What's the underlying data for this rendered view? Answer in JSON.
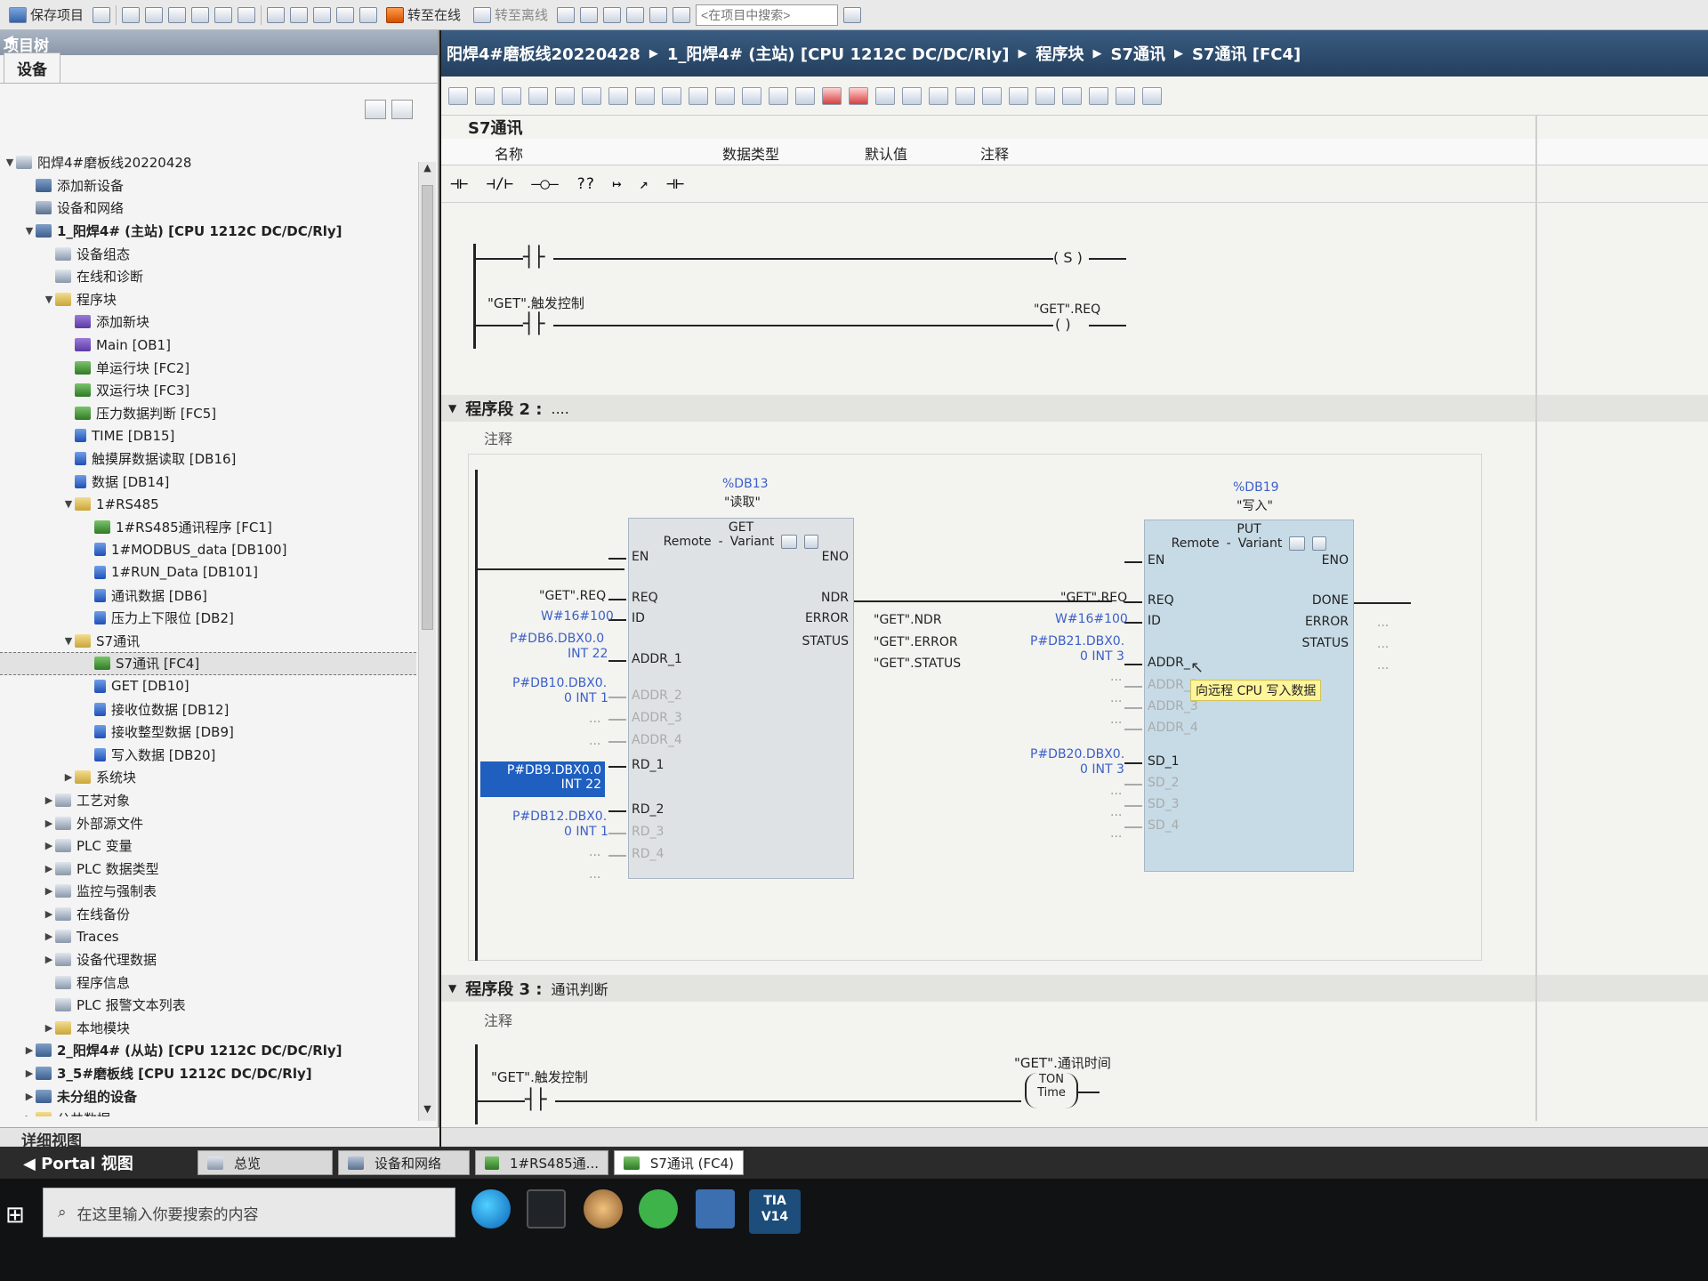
{
  "toolbar": {
    "save_label": "保存项目",
    "go_online": "转至在线",
    "go_offline": "转至离线",
    "search_placeholder": "<在项目中搜索>"
  },
  "left_panel": {
    "title": "项目树",
    "tab": "设备",
    "detail_view": "详细视图",
    "tree": [
      {
        "label": "阳焊4#磨板线20220428",
        "depth": 0,
        "arrow": "▼",
        "icon": "gen"
      },
      {
        "label": "添加新设备",
        "depth": 1,
        "arrow": "",
        "icon": "dev"
      },
      {
        "label": "设备和网络",
        "depth": 1,
        "arrow": "",
        "icon": "net"
      },
      {
        "label": "1_阳焊4# (主站) [CPU 1212C DC/DC/Rly]",
        "depth": 1,
        "arrow": "▼",
        "icon": "dev",
        "bold": true
      },
      {
        "label": "设备组态",
        "depth": 2,
        "arrow": "",
        "icon": "gen"
      },
      {
        "label": "在线和诊断",
        "depth": 2,
        "arrow": "",
        "icon": "gen"
      },
      {
        "label": "程序块",
        "depth": 2,
        "arrow": "▼",
        "icon": "fold"
      },
      {
        "label": "添加新块",
        "depth": 3,
        "arrow": "",
        "icon": "ob"
      },
      {
        "label": "Main [OB1]",
        "depth": 3,
        "arrow": "",
        "icon": "ob"
      },
      {
        "label": "单运行块 [FC2]",
        "depth": 3,
        "arrow": "",
        "icon": "fc"
      },
      {
        "label": "双运行块 [FC3]",
        "depth": 3,
        "arrow": "",
        "icon": "fc"
      },
      {
        "label": "压力数据判断 [FC5]",
        "depth": 3,
        "arrow": "",
        "icon": "fc"
      },
      {
        "label": "TIME [DB15]",
        "depth": 3,
        "arrow": "",
        "icon": "db"
      },
      {
        "label": "触摸屏数据读取 [DB16]",
        "depth": 3,
        "arrow": "",
        "icon": "db"
      },
      {
        "label": "数据 [DB14]",
        "depth": 3,
        "arrow": "",
        "icon": "db"
      },
      {
        "label": "1#RS485",
        "depth": 3,
        "arrow": "▼",
        "icon": "fold"
      },
      {
        "label": "1#RS485通讯程序 [FC1]",
        "depth": 4,
        "arrow": "",
        "icon": "fc"
      },
      {
        "label": "1#MODBUS_data [DB100]",
        "depth": 4,
        "arrow": "",
        "icon": "db"
      },
      {
        "label": "1#RUN_Data [DB101]",
        "depth": 4,
        "arrow": "",
        "icon": "db"
      },
      {
        "label": "通讯数据 [DB6]",
        "depth": 4,
        "arrow": "",
        "icon": "db"
      },
      {
        "label": "压力上下限位 [DB2]",
        "depth": 4,
        "arrow": "",
        "icon": "db"
      },
      {
        "label": "S7通讯",
        "depth": 3,
        "arrow": "▼",
        "icon": "fold"
      },
      {
        "label": "S7通讯 [FC4]",
        "depth": 4,
        "arrow": "",
        "icon": "fc",
        "selected": true
      },
      {
        "label": "GET [DB10]",
        "depth": 4,
        "arrow": "",
        "icon": "db"
      },
      {
        "label": "接收位数据 [DB12]",
        "depth": 4,
        "arrow": "",
        "icon": "db"
      },
      {
        "label": "接收整型数据 [DB9]",
        "depth": 4,
        "arrow": "",
        "icon": "db"
      },
      {
        "label": "写入数据 [DB20]",
        "depth": 4,
        "arrow": "",
        "icon": "db"
      },
      {
        "label": "系统块",
        "depth": 3,
        "arrow": "▶",
        "icon": "fold"
      },
      {
        "label": "工艺对象",
        "depth": 2,
        "arrow": "▶",
        "icon": "gen"
      },
      {
        "label": "外部源文件",
        "depth": 2,
        "arrow": "▶",
        "icon": "gen"
      },
      {
        "label": "PLC 变量",
        "depth": 2,
        "arrow": "▶",
        "icon": "gen"
      },
      {
        "label": "PLC 数据类型",
        "depth": 2,
        "arrow": "▶",
        "icon": "gen"
      },
      {
        "label": "监控与强制表",
        "depth": 2,
        "arrow": "▶",
        "icon": "gen"
      },
      {
        "label": "在线备份",
        "depth": 2,
        "arrow": "▶",
        "icon": "gen"
      },
      {
        "label": "Traces",
        "depth": 2,
        "arrow": "▶",
        "icon": "gen"
      },
      {
        "label": "设备代理数据",
        "depth": 2,
        "arrow": "▶",
        "icon": "gen"
      },
      {
        "label": "程序信息",
        "depth": 2,
        "arrow": "",
        "icon": "gen"
      },
      {
        "label": "PLC 报警文本列表",
        "depth": 2,
        "arrow": "",
        "icon": "gen"
      },
      {
        "label": "本地模块",
        "depth": 2,
        "arrow": "▶",
        "icon": "fold"
      },
      {
        "label": "2_阳焊4# (从站) [CPU 1212C DC/DC/Rly]",
        "depth": 1,
        "arrow": "▶",
        "icon": "dev",
        "bold": true
      },
      {
        "label": "3_5#磨板线 [CPU 1212C DC/DC/Rly]",
        "depth": 1,
        "arrow": "▶",
        "icon": "dev",
        "bold": true
      },
      {
        "label": "未分组的设备",
        "depth": 1,
        "arrow": "▶",
        "icon": "dev",
        "bold": true
      },
      {
        "label": "公共数据",
        "depth": 1,
        "arrow": "▶",
        "icon": "fold"
      }
    ]
  },
  "breadcrumb": [
    "阳焊4#磨板线20220428",
    "1_阳焊4# (主站) [CPU 1212C DC/DC/Rly]",
    "程序块",
    "S7通讯",
    "S7通讯 [FC4]"
  ],
  "block": {
    "name": "S7通讯",
    "columns": [
      "名称",
      "数据类型",
      "默认值",
      "注释"
    ]
  },
  "ladder_tools": [
    "⊣⊢",
    "⊣/⊢",
    "–◯–",
    "??",
    "↦",
    "↗",
    "⊣⊢"
  ],
  "segment1": {
    "coil_s": "( S )",
    "trigger_label": "\"GET\".触发控制",
    "coil_label": "\"GET\".REQ",
    "coil": "(  )"
  },
  "segment2": {
    "title": "程序段 2 :",
    "title_extra": "....",
    "comment": "注释",
    "get": {
      "db": "%DB13",
      "instance": "\"读取\"",
      "name": "GET",
      "remote": "Remote",
      "variant": "Variant",
      "in_pins": [
        "EN",
        "REQ",
        "ID",
        "ADDR_1",
        "ADDR_2",
        "ADDR_3",
        "ADDR_4",
        "RD_1",
        "RD_2",
        "RD_3",
        "RD_4"
      ],
      "out_pins": [
        "ENO",
        "NDR",
        "ERROR",
        "STATUS"
      ],
      "in_vals": {
        "req": "\"GET\".REQ",
        "id": "W#16#100",
        "addr1_a": "P#DB6.DBX0.0",
        "addr1_b": "INT 22",
        "addr2_a": "P#DB10.DBX0.",
        "addr2_b": "0 INT 1",
        "addr3": "...",
        "addr4": "...",
        "rd1_a": "P#DB9.DBX0.0",
        "rd1_b": "INT 22",
        "rd2_a": "P#DB12.DBX0.",
        "rd2_b": "0 INT 1",
        "rd3": "...",
        "rd4": "..."
      },
      "out_vals": {
        "ndr": "\"GET\".NDR",
        "error": "\"GET\".ERROR",
        "status": "\"GET\".STATUS"
      }
    },
    "put": {
      "db": "%DB19",
      "instance": "\"写入\"",
      "name": "PUT",
      "remote": "Remote",
      "variant": "Variant",
      "in_pins": [
        "EN",
        "REQ",
        "ID",
        "ADDR_",
        "ADDR_2",
        "ADDR_3",
        "ADDR_4",
        "SD_1",
        "SD_2",
        "SD_3",
        "SD_4"
      ],
      "out_pins": [
        "ENO",
        "DONE",
        "ERROR",
        "STATUS"
      ],
      "in_vals": {
        "req": "\"GET\".REQ",
        "id": "W#16#100",
        "addr1_a": "P#DB21.DBX0.",
        "addr1_b": "0 INT 3",
        "addr2": "...",
        "addr3": "...",
        "addr4": "...",
        "sd1_a": "P#DB20.DBX0.",
        "sd1_b": "0 INT 3",
        "sd2": "...",
        "sd3": "...",
        "sd4": "..."
      },
      "out_vals": {
        "done": "...",
        "error": "...",
        "status": "..."
      },
      "tooltip": "向远程 CPU 写入数据"
    }
  },
  "segment3": {
    "title": "程序段 3 :",
    "title_extra": "通讯判断",
    "comment": "注释",
    "contact_label": "\"GET\".触发控制",
    "timer_label": "\"GET\".通讯时间",
    "timer_type": "TON",
    "timer_sub": "Time"
  },
  "portal_bar": {
    "portal_view": "Portal 视图",
    "tabs": [
      "总览",
      "设备和网络",
      "1#RS485通...",
      "S7通讯 (FC4)"
    ]
  },
  "taskbar": {
    "search_placeholder": "在这里输入你要搜索的内容",
    "tia": "TIA\nV14"
  }
}
